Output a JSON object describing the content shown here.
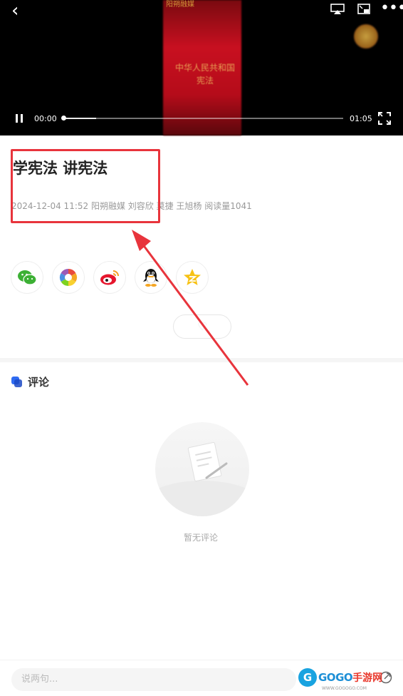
{
  "video": {
    "corner_logo": "阳朔融媒",
    "book_title_line1": "中华人民共和国",
    "book_title_line2": "宪法",
    "current_time": "00:00",
    "duration": "01:05",
    "progress": 0.0,
    "buffered": 0.12
  },
  "article": {
    "title": "学宪法 讲宪法",
    "meta": "2024-12-04 11:52 阳朔融媒 刘容欣 莫捷 王旭杨 阅读量1041"
  },
  "share_targets": [
    "wechat-icon",
    "moments-icon",
    "weibo-icon",
    "qq-icon",
    "qzone-icon"
  ],
  "comments": {
    "title": "评论",
    "empty_text": "暂无评论"
  },
  "bottom": {
    "input_placeholder": "说两句..."
  },
  "watermark": {
    "brand": "GOGO",
    "brand_cn": "手游网",
    "url": "WWW.GOGOGO.COM"
  },
  "colors": {
    "annotation_red": "#e8343c",
    "primary_blue": "#2f6bf2"
  }
}
